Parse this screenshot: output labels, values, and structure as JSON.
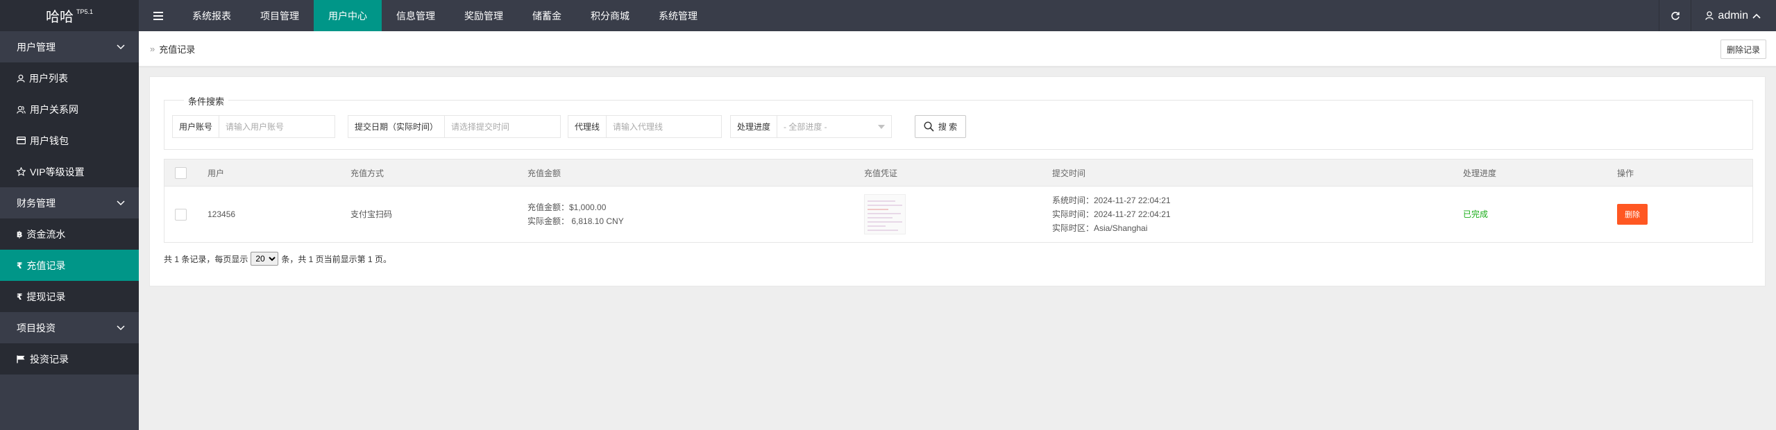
{
  "app": {
    "logo": "哈哈",
    "version": "TP5.1"
  },
  "topnav": {
    "items": [
      {
        "label": "系统报表"
      },
      {
        "label": "项目管理"
      },
      {
        "label": "用户中心"
      },
      {
        "label": "信息管理"
      },
      {
        "label": "奖励管理"
      },
      {
        "label": "储蓄金"
      },
      {
        "label": "积分商城"
      },
      {
        "label": "系统管理"
      }
    ],
    "active": "用户中心",
    "user": "admin"
  },
  "sidebar": {
    "groups": [
      {
        "label": "用户管理",
        "items": [
          {
            "label": "用户列表",
            "icon": "user-icon"
          },
          {
            "label": "用户关系网",
            "icon": "users-icon"
          },
          {
            "label": "用户钱包",
            "icon": "card-icon"
          },
          {
            "label": "VIP等级设置",
            "icon": "star-icon"
          }
        ]
      },
      {
        "label": "财务管理",
        "items": [
          {
            "label": "资金流水",
            "icon": "bitcoin-icon"
          },
          {
            "label": "充值记录",
            "icon": "rupee-icon"
          },
          {
            "label": "提现记录",
            "icon": "rupee-icon"
          }
        ]
      },
      {
        "label": "项目投资",
        "items": [
          {
            "label": "投资记录",
            "icon": "flag-icon"
          }
        ]
      }
    ],
    "active": "充值记录"
  },
  "breadcrumb": {
    "current": "充值记录",
    "delete_records_label": "删除记录"
  },
  "search": {
    "legend": "条件搜索",
    "user_account": {
      "label": "用户账号",
      "placeholder": "请输入用户账号"
    },
    "submit_date": {
      "label": "提交日期（实际时间）",
      "placeholder": "请选择提交时间"
    },
    "agent_line": {
      "label": "代理线",
      "placeholder": "请输入代理线"
    },
    "progress": {
      "label": "处理进度",
      "placeholder": "- 全部进度 -"
    },
    "button": "搜 索"
  },
  "table": {
    "headers": [
      "用户",
      "充值方式",
      "充值金额",
      "充值凭证",
      "提交时间",
      "处理进度",
      "操作"
    ],
    "rows": [
      {
        "user": "123456",
        "method": "支付宝扫码",
        "amount_line1": "充值金额：$1,000.00",
        "amount_line2": "实际金额： 6,818.10 CNY",
        "time_line1": "系统时间：2024-11-27 22:04:21",
        "time_line2": "实际时间：2024-11-27 22:04:21",
        "time_line3": "实际时区：Asia/Shanghai",
        "status": "已完成",
        "action": "删除"
      }
    ]
  },
  "pager": {
    "prefix": "共 1 条记录，每页显示",
    "page_size": "20",
    "suffix": "条，共 1 页当前显示第 1 页。"
  },
  "colors": {
    "topbar": "#393d49",
    "accent": "#009688",
    "danger": "#ff5722",
    "success": "#1aad19"
  }
}
